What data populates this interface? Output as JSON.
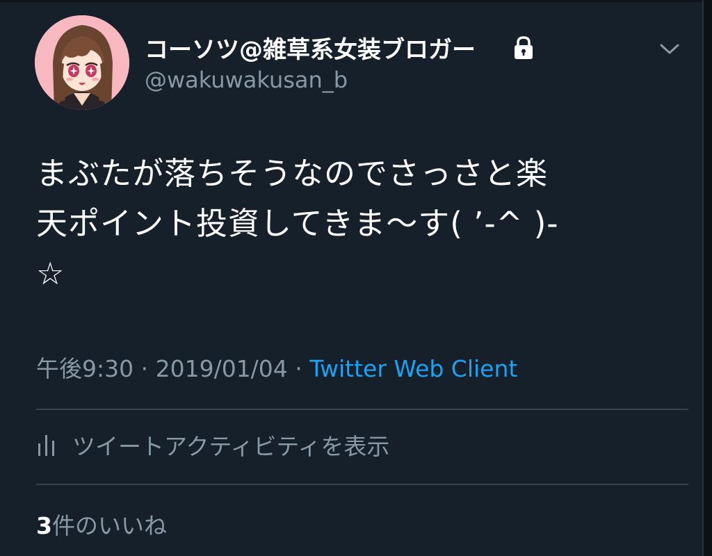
{
  "author": {
    "name": "コーソツ@雑草系女装ブロガー",
    "handle": "@wakuwakusan_b",
    "protected_icon": "lock-icon",
    "avatar_icon": "anime-girl-avatar"
  },
  "menu": {
    "icon": "chevron-down-icon"
  },
  "tweet": {
    "text": "まぶたが落ちそうなのでさっさと楽\n天ポイント投資してきま〜す( ’-^ )-\n☆",
    "time": "午後9:30",
    "separator1": " · ",
    "date": "2019/01/04",
    "separator2": " · ",
    "client": "Twitter Web Client"
  },
  "activity": {
    "icon": "bar-chart-icon",
    "label": "ツイートアクティビティを表示"
  },
  "likes": {
    "count": "3",
    "label": "件のいいね"
  },
  "colors": {
    "background": "#15202b",
    "primary_text": "#ffffff",
    "secondary_text": "#8899a6",
    "link": "#1da1f2",
    "divider": "#38444d"
  }
}
